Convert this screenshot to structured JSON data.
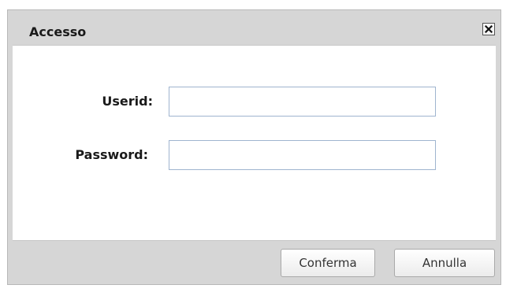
{
  "dialog": {
    "title": "Accesso",
    "close_symbol": "✖",
    "close_icon": "close-icon"
  },
  "form": {
    "userid_label": "Userid:",
    "userid_value": "",
    "password_label": "Password:",
    "password_value": ""
  },
  "buttons": {
    "confirm_label": "Conferma",
    "cancel_label": "Annulla"
  },
  "colors": {
    "frame": "#d6d6d6",
    "content_bg": "#ffffff",
    "input_border": "#9fb4cf"
  }
}
